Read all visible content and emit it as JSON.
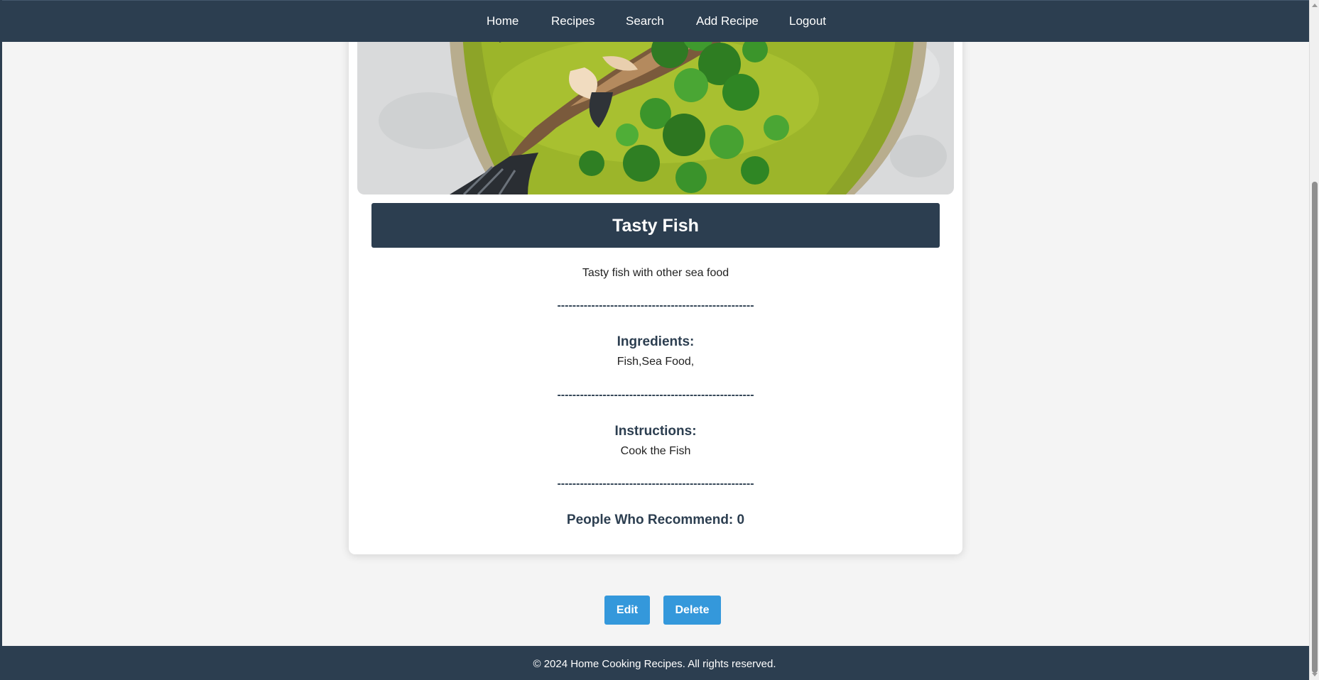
{
  "nav": {
    "home": "Home",
    "recipes": "Recipes",
    "search": "Search",
    "add_recipe": "Add Recipe",
    "logout": "Logout"
  },
  "recipe": {
    "title": "Tasty Fish",
    "description": "Tasty fish with other sea food",
    "divider": "----------------------------------------------------",
    "ingredients_heading": "Ingredients:",
    "ingredients": "Fish,Sea Food,",
    "instructions_heading": "Instructions:",
    "instructions": "Cook the Fish",
    "recommend_text": "People Who Recommend: 0"
  },
  "actions": {
    "edit": "Edit",
    "delete": "Delete"
  },
  "footer": {
    "text": "© 2024 Home Cooking Recipes. All rights reserved."
  },
  "colors": {
    "navbar": "#2c3e50",
    "button": "#3498db",
    "background": "#f4f4f4"
  }
}
